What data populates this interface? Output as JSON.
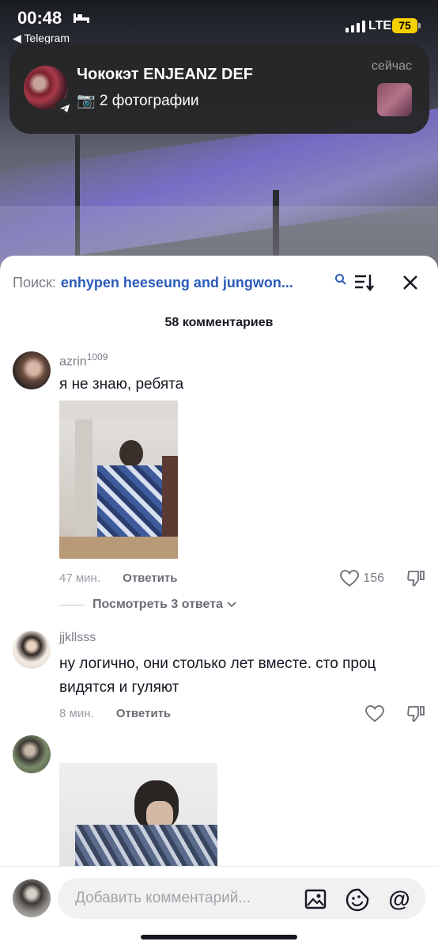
{
  "status_bar": {
    "time": "00:48",
    "back_app": "◀ Telegram",
    "network": "LTE",
    "battery": "75"
  },
  "notification": {
    "title": "Чококэт ENJEANZ DEF",
    "body": "📷 2 фотографии",
    "time": "сейчас"
  },
  "sheet": {
    "search_prefix": "Поиск:",
    "search_query": "enhypen heeseung and jungwon...",
    "comment_count": "58 комментариев"
  },
  "comments": [
    {
      "user": "azrin",
      "user_sup": "1009",
      "text": "я не знаю, ребята",
      "time": "47 мин.",
      "reply_label": "Ответить",
      "likes": "156",
      "view_replies": "Посмотреть 3 ответа"
    },
    {
      "user": "jjkllsss",
      "text": "ну логично, они столько лет вместе. сто проц видятся и гуляют",
      "time": "8 мин.",
      "reply_label": "Ответить",
      "likes": ""
    }
  ],
  "bottom": {
    "placeholder": "Добавить комментарий...",
    "at_symbol": "@"
  },
  "icons": {
    "sort": "sort-icon",
    "close": "close-icon",
    "heart": "heart-icon",
    "dislike": "dislike-icon",
    "image": "image-icon",
    "emoji": "emoji-icon"
  },
  "colors": {
    "search_query": "#2b5cb8",
    "battery": "#f5d000"
  }
}
